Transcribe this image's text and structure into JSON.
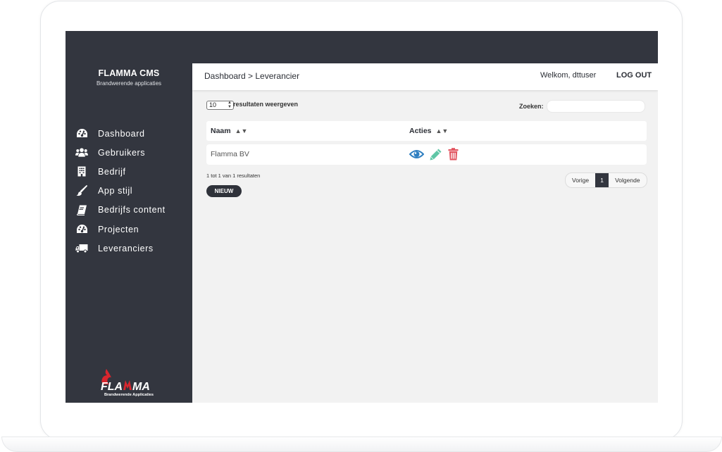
{
  "brand": {
    "title": "FLAMMA CMS",
    "subtitle": "Brandwerende applicaties"
  },
  "sidebar": {
    "items": [
      {
        "label": "Dashboard",
        "icon": "dashboard-icon"
      },
      {
        "label": "Gebruikers",
        "icon": "users-icon"
      },
      {
        "label": "Bedrijf",
        "icon": "building-icon"
      },
      {
        "label": "App stijl",
        "icon": "paintbrush-icon"
      },
      {
        "label": "Bedrijfs content",
        "icon": "book-icon"
      },
      {
        "label": "Projecten",
        "icon": "dashboard-icon"
      },
      {
        "label": "Leveranciers",
        "icon": "truck-icon"
      }
    ],
    "logo": {
      "wordmark": "FLAMMA",
      "tagline": "Brandwerende Applicaties"
    }
  },
  "header": {
    "breadcrumb": "Dashboard > Leverancier",
    "welcome_prefix": "Welkom,",
    "username": "dttuser",
    "logout": "LOG OUT"
  },
  "table_controls": {
    "page_length": "10",
    "page_length_suffix": "resultaten weergeven",
    "search_label": "Zoeken:",
    "search_value": ""
  },
  "table": {
    "columns": [
      "Naam",
      "Acties"
    ],
    "rows": [
      {
        "naam": "Flamma BV",
        "actions": [
          "view-icon",
          "edit-icon",
          "delete-icon"
        ]
      }
    ]
  },
  "footer": {
    "info": "1 tot 1 van 1 resultaten",
    "new_button": "NIEUW",
    "pagination": {
      "prev": "Vorige",
      "current": "1",
      "next": "Volgende"
    }
  },
  "colors": {
    "sidebar_bg": "#33363f",
    "content_bg": "#f2f2f2",
    "view": "#2f7fc1",
    "edit": "#5fc6a6",
    "delete": "#e25560",
    "flame": "#d9262e"
  }
}
